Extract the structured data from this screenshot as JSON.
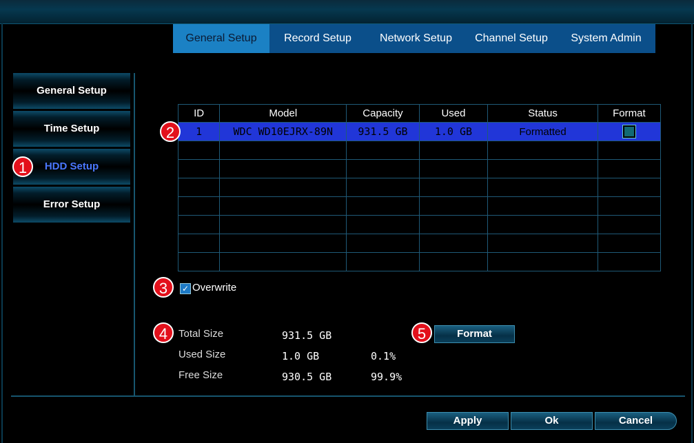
{
  "tabs": [
    "General Setup",
    "Record Setup",
    "Network Setup",
    "Channel Setup",
    "System Admin"
  ],
  "active_tab": "General Setup",
  "sidebar": [
    "General Setup",
    "Time Setup",
    "HDD Setup",
    "Error Setup"
  ],
  "active_sidebar": "HDD Setup",
  "table": {
    "headers": [
      "ID",
      "Model",
      "Capacity",
      "Used",
      "Status",
      "Format"
    ],
    "rows": [
      {
        "id": "1",
        "model": "WDC WD10EJRX-89N",
        "capacity": "931.5 GB",
        "used": "1.0 GB",
        "status": "Formatted"
      }
    ],
    "empty_rows": 7
  },
  "overwrite": {
    "label": "Overwrite",
    "checked": true
  },
  "sizes": {
    "total_label": "Total Size",
    "total_value": "931.5 GB",
    "used_label": "Used Size",
    "used_value": "1.0 GB",
    "used_pct": "0.1%",
    "free_label": "Free Size",
    "free_value": "930.5 GB",
    "free_pct": "99.9%"
  },
  "format_button": "Format",
  "footer": {
    "apply": "Apply",
    "ok": "Ok",
    "cancel": "Cancel"
  },
  "badges": [
    "1",
    "2",
    "3",
    "4",
    "5"
  ]
}
